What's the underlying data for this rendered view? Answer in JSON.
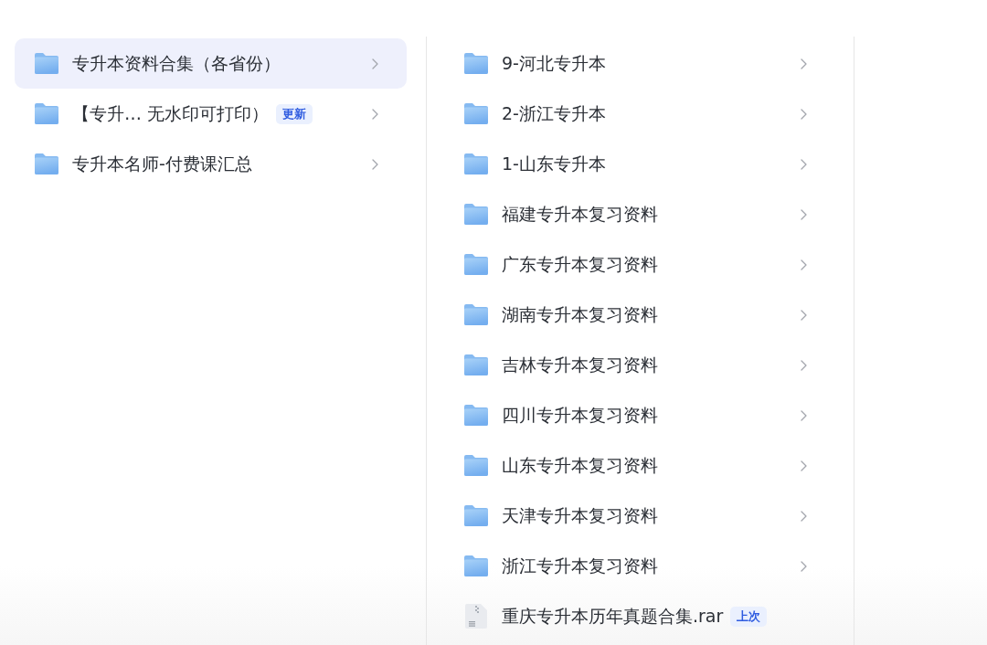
{
  "columns": [
    {
      "items": [
        {
          "kind": "folder",
          "name": "专升本资料合集（各省份）",
          "selected": true
        },
        {
          "kind": "folder",
          "name": "【专升…  无水印可打印）",
          "badge": "更新",
          "selected": false
        },
        {
          "kind": "folder",
          "name": "专升本名师-付费课汇总",
          "selected": false
        }
      ]
    },
    {
      "items": [
        {
          "kind": "folder",
          "name": "9-河北专升本",
          "selected": false
        },
        {
          "kind": "folder",
          "name": "2-浙江专升本",
          "selected": false
        },
        {
          "kind": "folder",
          "name": "1-山东专升本",
          "selected": false
        },
        {
          "kind": "folder",
          "name": "福建专升本复习资料",
          "selected": false
        },
        {
          "kind": "folder",
          "name": "广东专升本复习资料",
          "selected": false
        },
        {
          "kind": "folder",
          "name": "湖南专升本复习资料",
          "selected": false
        },
        {
          "kind": "folder",
          "name": "吉林专升本复习资料",
          "selected": false
        },
        {
          "kind": "folder",
          "name": "四川专升本复习资料",
          "selected": false
        },
        {
          "kind": "folder",
          "name": "山东专升本复习资料",
          "selected": false
        },
        {
          "kind": "folder",
          "name": "天津专升本复习资料",
          "selected": false
        },
        {
          "kind": "folder",
          "name": "浙江专升本复习资料",
          "selected": false
        },
        {
          "kind": "file",
          "name": "重庆专升本历年真题合集.rar",
          "badge": "上次",
          "selected": false
        }
      ]
    }
  ]
}
